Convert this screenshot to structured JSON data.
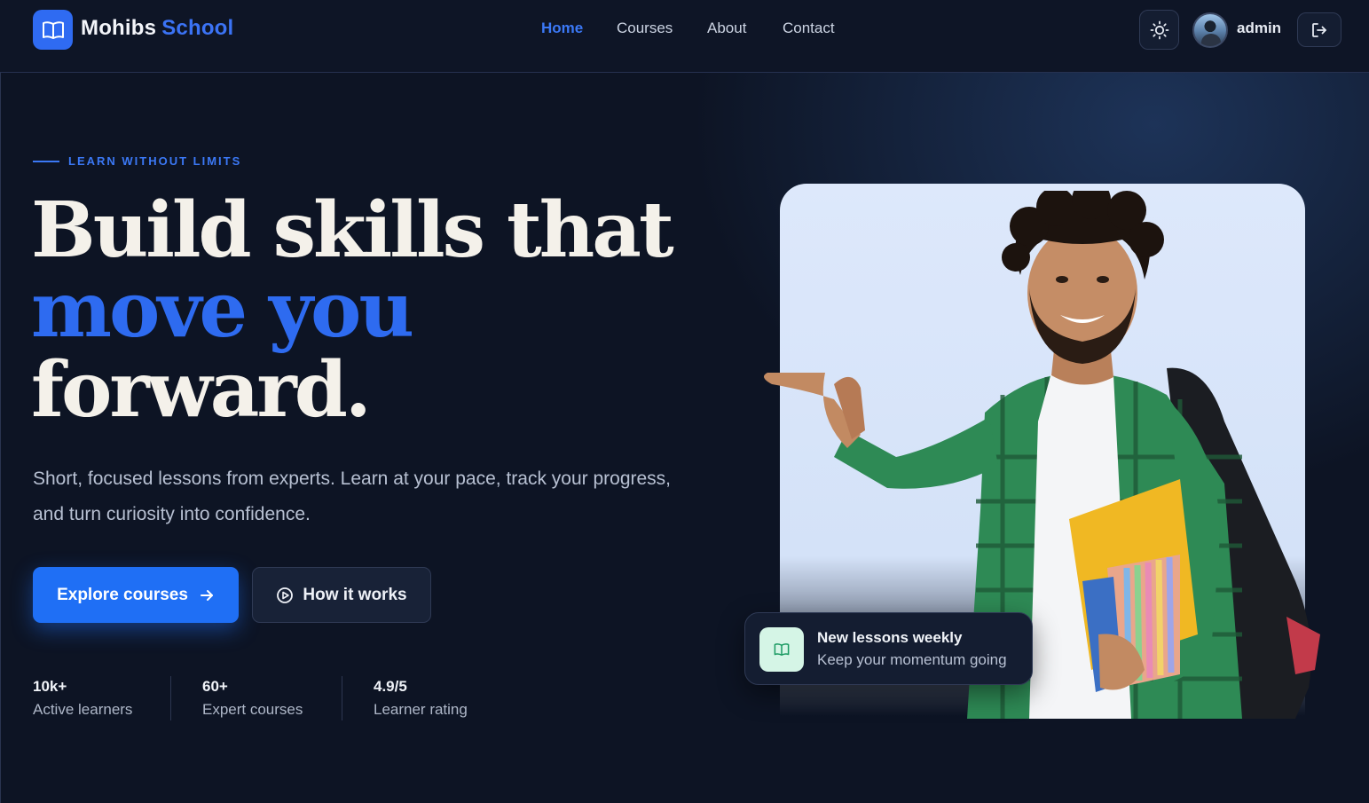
{
  "brand": {
    "name_part1": "Mohibs",
    "name_part2": "School",
    "logo_icon": "open-book-icon"
  },
  "nav": {
    "links": [
      {
        "label": "Home",
        "active": true
      },
      {
        "label": "Courses",
        "active": false
      },
      {
        "label": "About",
        "active": false
      },
      {
        "label": "Contact",
        "active": false
      }
    ],
    "theme_icon": "sun-icon",
    "user": {
      "name": "admin",
      "avatar_icon": "user-avatar"
    },
    "logout_icon": "logout-icon"
  },
  "hero": {
    "eyebrow": "LEARN WITHOUT LIMITS",
    "headline_line1": "Build skills that",
    "headline_accent": "move you",
    "headline_line3": "forward.",
    "subtext": "Short, focused lessons from experts. Learn at your pace, track your progress, and turn curiosity into confidence.",
    "primary_button": "Explore courses",
    "secondary_button": "How it works",
    "stats": [
      {
        "value": "10k+",
        "label": "Active learners"
      },
      {
        "value": "60+",
        "label": "Expert courses"
      },
      {
        "value": "4.9/5",
        "label": "Learner rating"
      }
    ]
  },
  "notification": {
    "title": "New lessons weekly",
    "subtitle": "Keep your momentum going",
    "icon": "open-book-icon"
  },
  "colors": {
    "accent": "#2f6bf2",
    "background": "#0d1424",
    "card_bg": "#dde8fb",
    "notif_icon_bg": "#d5f5e6"
  }
}
